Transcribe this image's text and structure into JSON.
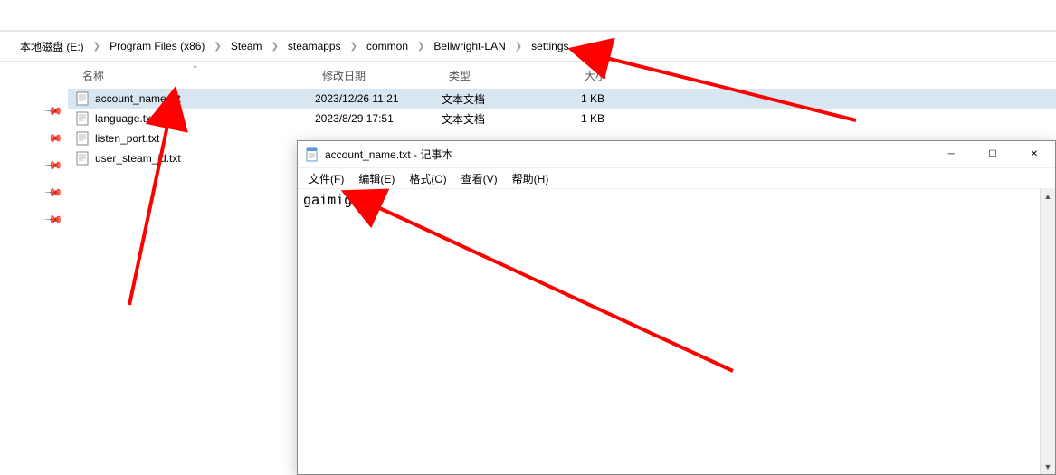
{
  "breadcrumb": [
    "本地磁盘 (E:)",
    "Program Files (x86)",
    "Steam",
    "steamapps",
    "common",
    "Bellwright-LAN",
    "settings"
  ],
  "columns": {
    "name": "名称",
    "date": "修改日期",
    "type": "类型",
    "size": "大小"
  },
  "files": [
    {
      "name": "account_name.txt",
      "date": "2023/12/26 11:21",
      "type": "文本文档",
      "size": "1 KB",
      "selected": true
    },
    {
      "name": "language.txt",
      "date": "2023/8/29 17:51",
      "type": "文本文档",
      "size": "1 KB",
      "selected": false
    },
    {
      "name": "listen_port.txt",
      "date": "",
      "type": "",
      "size": "",
      "selected": false
    },
    {
      "name": "user_steam_id.txt",
      "date": "",
      "type": "",
      "size": "",
      "selected": false
    }
  ],
  "notepad": {
    "title": "account_name.txt - 记事本",
    "menu": [
      "文件(F)",
      "编辑(E)",
      "格式(O)",
      "查看(V)",
      "帮助(H)"
    ],
    "content": "gaimignzi"
  }
}
